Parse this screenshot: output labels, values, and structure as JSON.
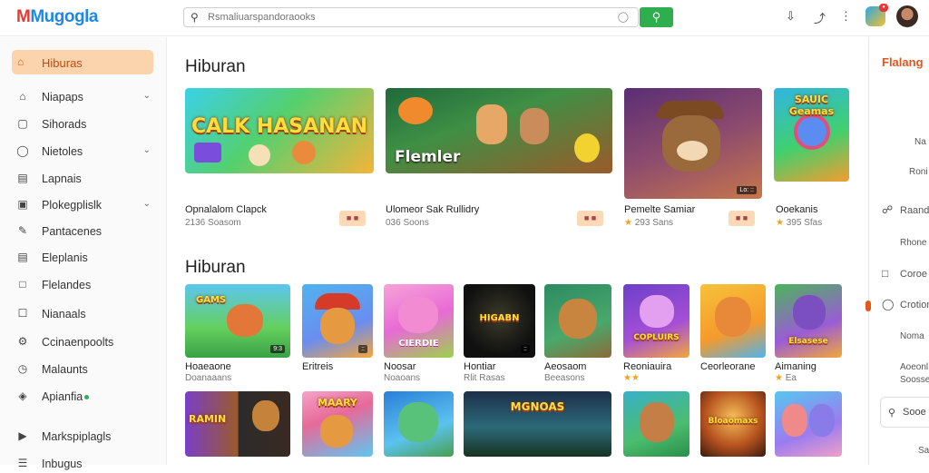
{
  "app": {
    "name": "Mugogla"
  },
  "search": {
    "placeholder": "Rsmaliuarspandoraooks"
  },
  "sidebar": {
    "active": "Hiburas",
    "items": [
      {
        "icon": "home-icon",
        "label": "Niapaps",
        "chevron": true
      },
      {
        "icon": "store-icon",
        "label": "Sihorads",
        "chevron": false
      },
      {
        "icon": "info-icon",
        "label": "Nietoles",
        "chevron": true
      },
      {
        "icon": "document-icon",
        "label": "Lapnais",
        "chevron": false
      },
      {
        "icon": "book-icon",
        "label": "Plokegplislk",
        "chevron": true
      },
      {
        "icon": "pen-icon",
        "label": "Pantacenes",
        "chevron": false
      },
      {
        "icon": "page-icon",
        "label": "Eleplanis",
        "chevron": false
      },
      {
        "icon": "file-icon",
        "label": "Flelandes",
        "chevron": false
      },
      {
        "icon": "chat-icon",
        "label": "Nianaals",
        "chevron": false
      },
      {
        "icon": "settings-icon",
        "label": "Ccinaenpoolts",
        "chevron": false
      },
      {
        "icon": "clock-icon",
        "label": "Malaunts",
        "chevron": false
      },
      {
        "icon": "shield-icon",
        "label": "Apianfia",
        "chevron": false
      }
    ],
    "bottom": [
      "Markspiplagls",
      "Inbugus"
    ]
  },
  "featured": {
    "title": "Hiburan",
    "items": [
      {
        "art": "CALK HASANAN",
        "name": "Opnalalom Clapck",
        "meta": "2136 Soasom",
        "pill": "■ ■",
        "stars": ""
      },
      {
        "art": "Flemler",
        "name": "Ulomeor Sak Rullidry",
        "meta": "036 Soons",
        "pill": "■ ■",
        "stars": ""
      },
      {
        "art": "",
        "name": "Pemelte Samiar",
        "meta": "293 Sans",
        "pill": "■ ■",
        "stars": "★",
        "tag": "Lo: ::"
      },
      {
        "art": "SAUIC Geamas",
        "name": "Ooekanis",
        "meta": "395 Sfas",
        "pill": "",
        "stars": "★"
      }
    ]
  },
  "grid": {
    "title": "Hiburan",
    "row1": [
      {
        "art": "GAMS",
        "name": "Hoaeaone",
        "meta": "Doanaaans",
        "stars": "",
        "tag": "9:3"
      },
      {
        "art": "",
        "name": "Eritreis",
        "meta": "",
        "stars": "",
        "tag": "::"
      },
      {
        "art": "CIERDIE",
        "name": "Noosar",
        "meta": "Noaoans",
        "stars": "",
        "tag": ""
      },
      {
        "art": "HIGABN",
        "name": "Hontiar",
        "meta": "Rlit Rasas",
        "stars": "",
        "tag": "::"
      },
      {
        "art": "",
        "name": "Aeosaom",
        "meta": "Beeasons",
        "stars": "",
        "tag": ""
      },
      {
        "art": "COPLUIRS",
        "name": "Reoniauira",
        "meta": "",
        "stars": "★★",
        "tag": ""
      },
      {
        "art": "",
        "name": "Ceorleorane",
        "meta": "",
        "stars": "",
        "tag": ""
      },
      {
        "art": "Elsasese",
        "name": "Aimaning",
        "meta": "Ea",
        "stars": "★",
        "tag": ""
      }
    ],
    "row2": [
      {
        "art": "RAMIN",
        "tag": ""
      },
      {
        "art": "MAARY",
        "tag": ""
      },
      {
        "art": "",
        "tag": ""
      },
      {
        "art": "MGNOAS",
        "tag": ""
      },
      {
        "art": "",
        "tag": ""
      },
      {
        "art": "Bloaomaxs",
        "tag": ""
      },
      {
        "art": "",
        "tag": ""
      }
    ]
  },
  "right_panel": {
    "title": "Flalang",
    "items": [
      "Na",
      "Roni",
      "Raand",
      "Rhone",
      "Coroe",
      "Crotion",
      "Noma",
      "Aoeonl",
      "Soosseno",
      "Sooe",
      "Sa"
    ]
  }
}
